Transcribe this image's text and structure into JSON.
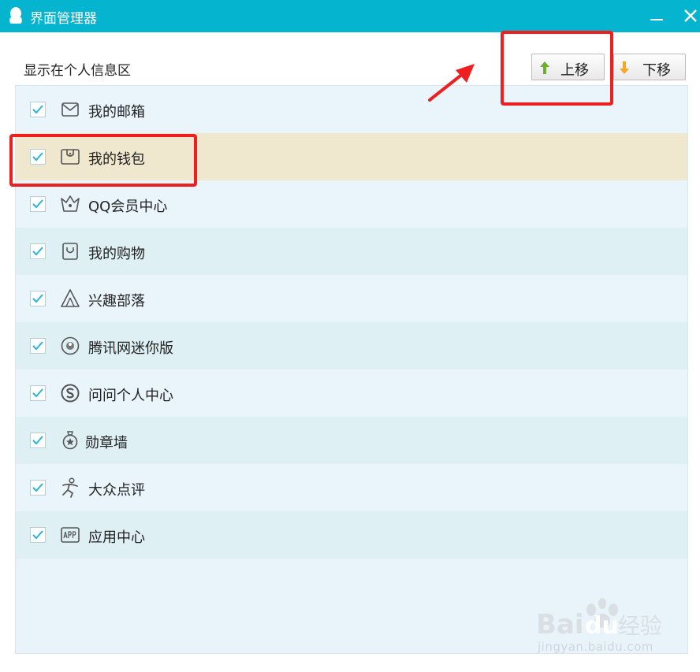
{
  "window": {
    "title": "界面管理器",
    "app_icon": "qq-penguin-icon",
    "accent": "#05b4cf"
  },
  "section": {
    "label": "显示在个人信息区"
  },
  "toolbar": {
    "move_up_label": "上移",
    "move_up_icon": "arrow-up-icon",
    "move_up_color": "#6ab12e",
    "move_down_label": "下移",
    "move_down_icon": "arrow-down-icon",
    "move_down_color": "#f5a623"
  },
  "items": [
    {
      "label": "我的邮箱",
      "icon": "mail-icon",
      "checked": true,
      "selected": false
    },
    {
      "label": "我的钱包",
      "icon": "wallet-icon",
      "checked": true,
      "selected": true
    },
    {
      "label": "QQ会员中心",
      "icon": "crown-icon",
      "checked": true,
      "selected": false
    },
    {
      "label": "我的购物",
      "icon": "shopping-bag-icon",
      "checked": true,
      "selected": false
    },
    {
      "label": "兴趣部落",
      "icon": "tent-icon",
      "checked": true,
      "selected": false
    },
    {
      "label": "腾讯网迷你版",
      "icon": "globe-icon",
      "checked": true,
      "selected": false
    },
    {
      "label": "问问个人中心",
      "icon": "wenwen-icon",
      "checked": true,
      "selected": false
    },
    {
      "label": "勋章墙",
      "icon": "medal-icon",
      "checked": true,
      "selected": false
    },
    {
      "label": "大众点评",
      "icon": "dianping-icon",
      "checked": true,
      "selected": false
    },
    {
      "label": "应用中心",
      "icon": "app-icon",
      "checked": true,
      "selected": false
    }
  ],
  "annotations": {
    "highlight_color": "#ee1f1f"
  },
  "watermark": {
    "logo_text": "Baidu经验",
    "url": "jingyan.baidu.com"
  }
}
